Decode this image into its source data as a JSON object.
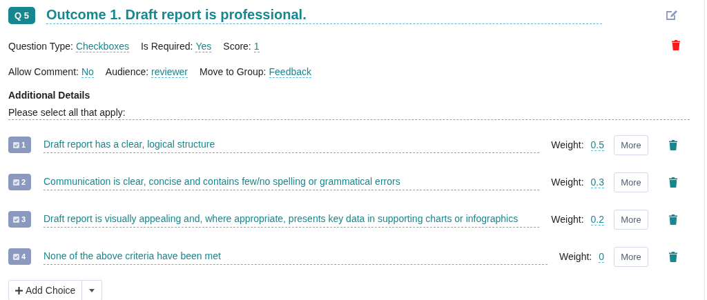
{
  "question": {
    "number": "Q 5",
    "title": "Outcome 1. Draft report is professional.",
    "fields_row_1": [
      {
        "label": "Question Type:",
        "value": "Checkboxes"
      },
      {
        "label": "Is Required:",
        "value": "Yes"
      },
      {
        "label": "Score:",
        "value": "1"
      }
    ],
    "fields_row_2": [
      {
        "label": "Allow Comment:",
        "value": "No"
      },
      {
        "label": "Audience:",
        "value": "reviewer"
      },
      {
        "label": "Move to Group:",
        "value": "Feedback"
      }
    ]
  },
  "additional_details": {
    "heading": "Additional Details",
    "prompt": "Please select all that apply:"
  },
  "choices": [
    {
      "number": "1",
      "text": "Draft report has a clear, logical structure",
      "weight_label": "Weight:",
      "weight": "0.5",
      "more": "More"
    },
    {
      "number": "2",
      "text": "Communication is clear, concise and contains few/no spelling or grammatical errors",
      "weight_label": "Weight:",
      "weight": "0.3",
      "more": "More"
    },
    {
      "number": "3",
      "text": "Draft report is visually appealing and, where appropriate, presents key data in supporting charts or infographics",
      "weight_label": "Weight:",
      "weight": "0.2",
      "more": "More"
    },
    {
      "number": "4",
      "text": "None of the above criteria have been met",
      "weight_label": "Weight:",
      "weight": "0",
      "more": "More"
    }
  ],
  "add_choice": {
    "label": "Add Choice"
  }
}
